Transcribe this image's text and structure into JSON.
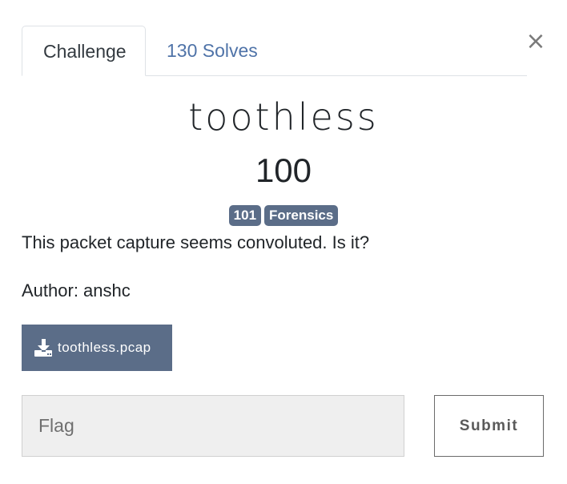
{
  "close": {
    "symbol": "×"
  },
  "tabs": [
    {
      "label": "Challenge",
      "active": true
    },
    {
      "label": "130 Solves",
      "active": false
    }
  ],
  "challenge": {
    "name": "toothless",
    "points": "100",
    "tags": [
      "101",
      "Forensics"
    ],
    "description": "This packet capture seems convoluted. Is it?",
    "author": "Author: anshc"
  },
  "file": {
    "label": "toothless.pcap",
    "icon": "download-icon"
  },
  "form": {
    "flag_placeholder": "Flag",
    "flag_value": "",
    "submit_label": "Submit"
  },
  "colors": {
    "accent": "#5b6d88",
    "link": "#4f73a8",
    "input_bg": "#efefef"
  }
}
